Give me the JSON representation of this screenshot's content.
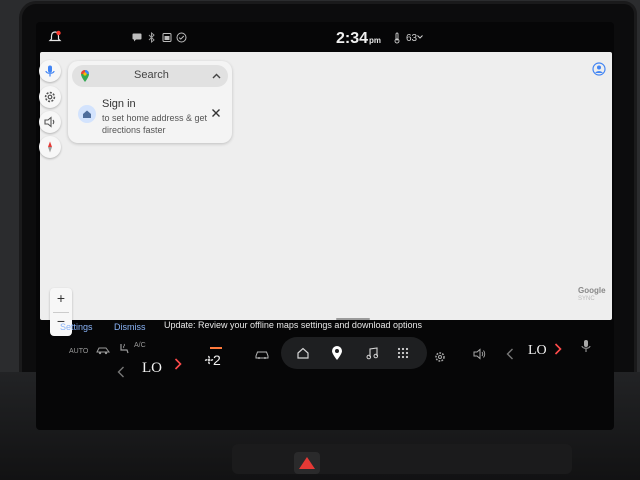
{
  "status_bar": {
    "time": "2:34",
    "ampm": "pm",
    "outside_temp": "63"
  },
  "search_card": {
    "search_label": "Search",
    "signin_title": "Sign in",
    "signin_subtitle": "to set home address & get directions faster"
  },
  "map": {
    "zoom_in": "+",
    "zoom_out": "−",
    "attribution": "Google"
  },
  "notification": {
    "settings_label": "Settings",
    "dismiss_label": "Dismiss",
    "message": "Update: Review your offline maps settings and download options",
    "sync_label": "SYNC"
  },
  "climate": {
    "auto_label": "AUTO",
    "ac_label": "A/C",
    "left_temp": "LO",
    "fan_speed": "2",
    "right_temp": "LO"
  },
  "colors": {
    "accent_blue": "#8ab4f8",
    "chevron_red": "#ff4b4b",
    "map_bg": "#eeeeee"
  }
}
